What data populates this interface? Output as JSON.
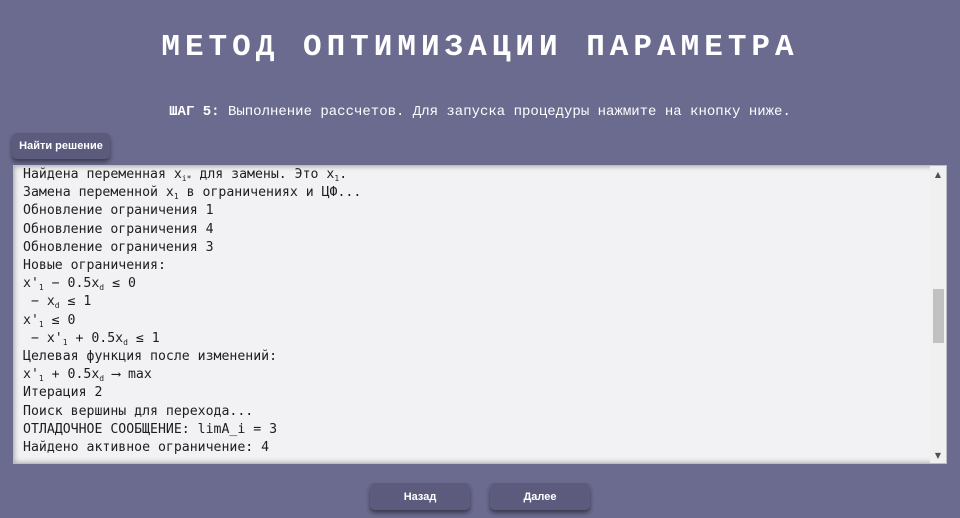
{
  "header": {
    "title": "МЕТОД ОПТИМИЗАЦИИ ПАРАМЕТРА",
    "step_label": "ШАГ 5:",
    "step_text": " Выполнение рассчетов. Для запуска процедуры нажмите на кнопку ниже."
  },
  "toolbar": {
    "solve_label": "Найти решение"
  },
  "output": {
    "lines": [
      {
        "parts": [
          {
            "t": "Найдена переменная x"
          },
          {
            "sub": "i*"
          },
          {
            "t": " для замены. Это x"
          },
          {
            "sub": "1"
          },
          {
            "t": "."
          }
        ]
      },
      {
        "parts": [
          {
            "t": "Замена переменной x"
          },
          {
            "sub": "1"
          },
          {
            "t": " в ограничениях и ЦФ..."
          }
        ]
      },
      {
        "parts": [
          {
            "t": "Обновление ограничения 1"
          }
        ]
      },
      {
        "parts": [
          {
            "t": "Обновление ограничения 4"
          }
        ]
      },
      {
        "parts": [
          {
            "t": "Обновление ограничения 3"
          }
        ]
      },
      {
        "parts": [
          {
            "t": "Новые ограничения:"
          }
        ]
      },
      {
        "parts": [
          {
            "t": "x'"
          },
          {
            "sub": "1"
          },
          {
            "t": " − 0.5x"
          },
          {
            "sub": "d"
          },
          {
            "t": " ≤ 0"
          }
        ]
      },
      {
        "parts": [
          {
            "t": " − x"
          },
          {
            "sub": "d"
          },
          {
            "t": " ≤ 1"
          }
        ]
      },
      {
        "parts": [
          {
            "t": "x'"
          },
          {
            "sub": "1"
          },
          {
            "t": " ≤ 0"
          }
        ]
      },
      {
        "parts": [
          {
            "t": " − x'"
          },
          {
            "sub": "1"
          },
          {
            "t": " + 0.5x"
          },
          {
            "sub": "d"
          },
          {
            "t": " ≤ 1"
          }
        ]
      },
      {
        "parts": [
          {
            "t": "Целевая функция после изменений:"
          }
        ]
      },
      {
        "parts": [
          {
            "t": "x'"
          },
          {
            "sub": "1"
          },
          {
            "t": " + 0.5x"
          },
          {
            "sub": "d"
          },
          {
            "t": " ⟶ max"
          }
        ]
      },
      {
        "parts": [
          {
            "t": "Итерация 2"
          }
        ]
      },
      {
        "parts": [
          {
            "t": "Поиск вершины для перехода..."
          }
        ]
      },
      {
        "parts": [
          {
            "t": "ОТЛАДОЧНОЕ СООБЩЕНИЕ: limA_i = 3"
          }
        ]
      },
      {
        "parts": [
          {
            "t": "Найдено активное ограничение: 4"
          }
        ]
      }
    ],
    "scroll_up_icon": "▲",
    "scroll_down_icon": "▼"
  },
  "navigation": {
    "back_label": "Назад",
    "next_label": "Далее"
  },
  "colors": {
    "background": "#6b6a8f",
    "button": "#5c5a7d",
    "output_bg": "#f2f2f4",
    "output_text": "#1e1e1e"
  }
}
